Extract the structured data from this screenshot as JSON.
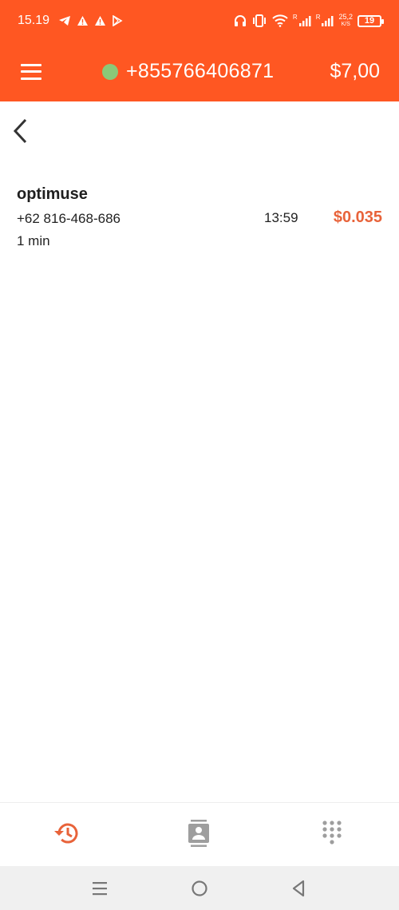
{
  "status_bar": {
    "time": "15.19",
    "net_speed_value": "25,2",
    "net_speed_unit": "K/S",
    "battery": "19",
    "signal_label_1": "R",
    "signal_label_2": "R"
  },
  "app_bar": {
    "phone_number": "+855766406871",
    "balance": "$7,00",
    "online_color": "#8bc978"
  },
  "call_history": [
    {
      "name": "optimuse",
      "number": "+62 816-468-686",
      "duration": "1 min",
      "time": "13:59",
      "cost": "$0.035"
    }
  ],
  "bottom_nav": [
    {
      "icon": "history-icon",
      "active": true
    },
    {
      "icon": "contacts-icon",
      "active": false
    },
    {
      "icon": "dialpad-icon",
      "active": false
    }
  ],
  "colors": {
    "primary": "#ff5722",
    "accent": "#e8633a",
    "inactive_icon": "#9e9e9e"
  }
}
